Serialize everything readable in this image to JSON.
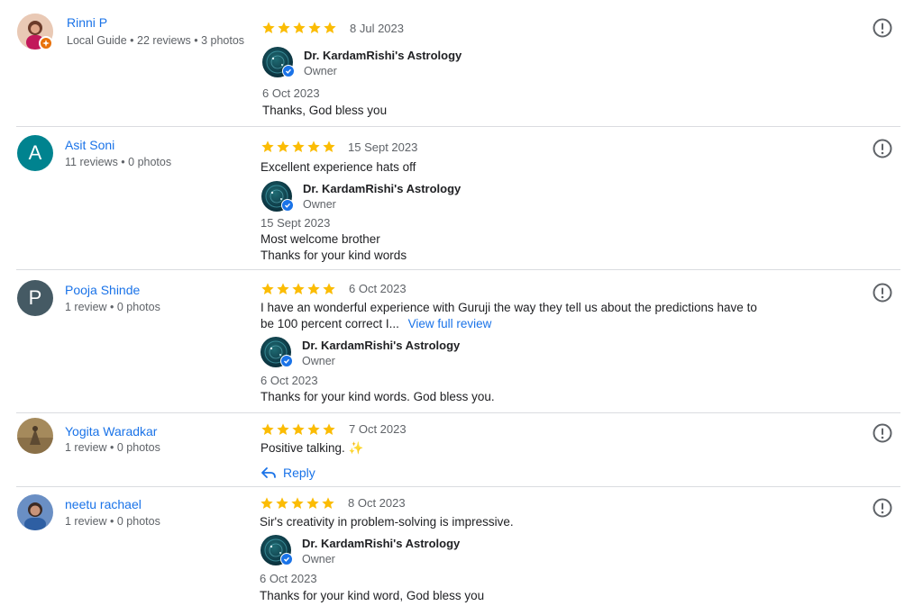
{
  "reviews": [
    {
      "name": "Rinni P",
      "meta": "Local Guide • 22 reviews • 3 photos",
      "avatar": "photo",
      "date": "8 Jul 2023",
      "text": "",
      "owner": {
        "name": "Dr. KardamRishi's Astrology",
        "role": "Owner",
        "date": "6 Oct 2023",
        "lines": [
          "Thanks, God bless you"
        ]
      }
    },
    {
      "name": "Asit Soni",
      "meta": "11 reviews • 0 photos",
      "avatar_letter": "A",
      "avatar_color": "#00838f",
      "date": "15 Sept 2023",
      "text": "Excellent experience hats off",
      "owner": {
        "name": "Dr. KardamRishi's Astrology",
        "role": "Owner",
        "date": "15 Sept 2023",
        "lines": [
          "Most welcome brother",
          "Thanks for your kind words"
        ]
      }
    },
    {
      "name": "Pooja Shinde",
      "meta": "1 review • 0 photos",
      "avatar_letter": "P",
      "avatar_color": "#455a64",
      "date": "6 Oct 2023",
      "text_line1": "I have an wonderful experience with Guruji the way they tell us about the predictions have to",
      "text_line2": "be 100 percent correct I...",
      "view_full": "View full review",
      "owner": {
        "name": "Dr. KardamRishi's Astrology",
        "role": "Owner",
        "date": "6 Oct 2023",
        "lines": [
          "Thanks for your kind words. God bless you."
        ]
      }
    },
    {
      "name": "Yogita Waradkar",
      "meta": "1 review • 0 photos",
      "avatar": "photo",
      "date": "7 Oct 2023",
      "text": "Positive talking. ✨",
      "reply_label": "Reply"
    },
    {
      "name": "neetu rachael",
      "meta": "1 review • 0 photos",
      "avatar": "photo",
      "date": "8 Oct 2023",
      "text": "Sir's creativity in problem-solving is impressive.",
      "owner": {
        "name": "Dr. KardamRishi's Astrology",
        "role": "Owner",
        "date": "6 Oct 2023",
        "lines": [
          "Thanks for your kind word, God bless you"
        ]
      }
    }
  ],
  "rating_stars": 5,
  "colors": {
    "star": "#fbbc04",
    "link": "#1a73e8",
    "divider": "#dadce0"
  },
  "icons": {
    "report": "report-flag-icon",
    "reply": "reply-arrow-icon",
    "verified": "verified-check-icon"
  }
}
